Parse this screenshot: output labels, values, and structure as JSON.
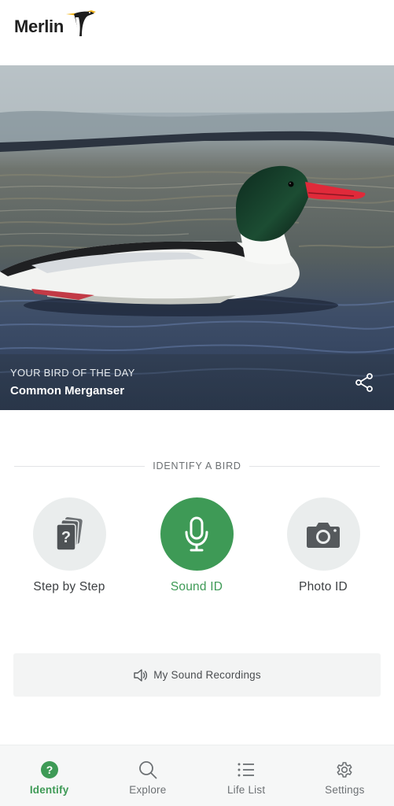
{
  "app": {
    "name": "Merlin"
  },
  "bird_of_day": {
    "eyebrow": "YOUR BIRD OF THE DAY",
    "name": "Common Merganser"
  },
  "identify": {
    "section_label": "IDENTIFY A BIRD",
    "options": [
      {
        "label": "Step by Step",
        "icon": "cards-question-icon",
        "active": false
      },
      {
        "label": "Sound ID",
        "icon": "microphone-icon",
        "active": true
      },
      {
        "label": "Photo ID",
        "icon": "camera-icon",
        "active": false
      }
    ],
    "recordings_label": "My Sound Recordings"
  },
  "nav": {
    "items": [
      {
        "label": "Identify",
        "icon": "question-circle-icon",
        "active": true
      },
      {
        "label": "Explore",
        "icon": "search-icon",
        "active": false
      },
      {
        "label": "Life List",
        "icon": "list-icon",
        "active": false
      },
      {
        "label": "Settings",
        "icon": "gear-icon",
        "active": false
      }
    ]
  },
  "colors": {
    "accent": "#3e9a56",
    "circle_bg": "#eaeded",
    "nav_bg": "#f6f7f7"
  }
}
